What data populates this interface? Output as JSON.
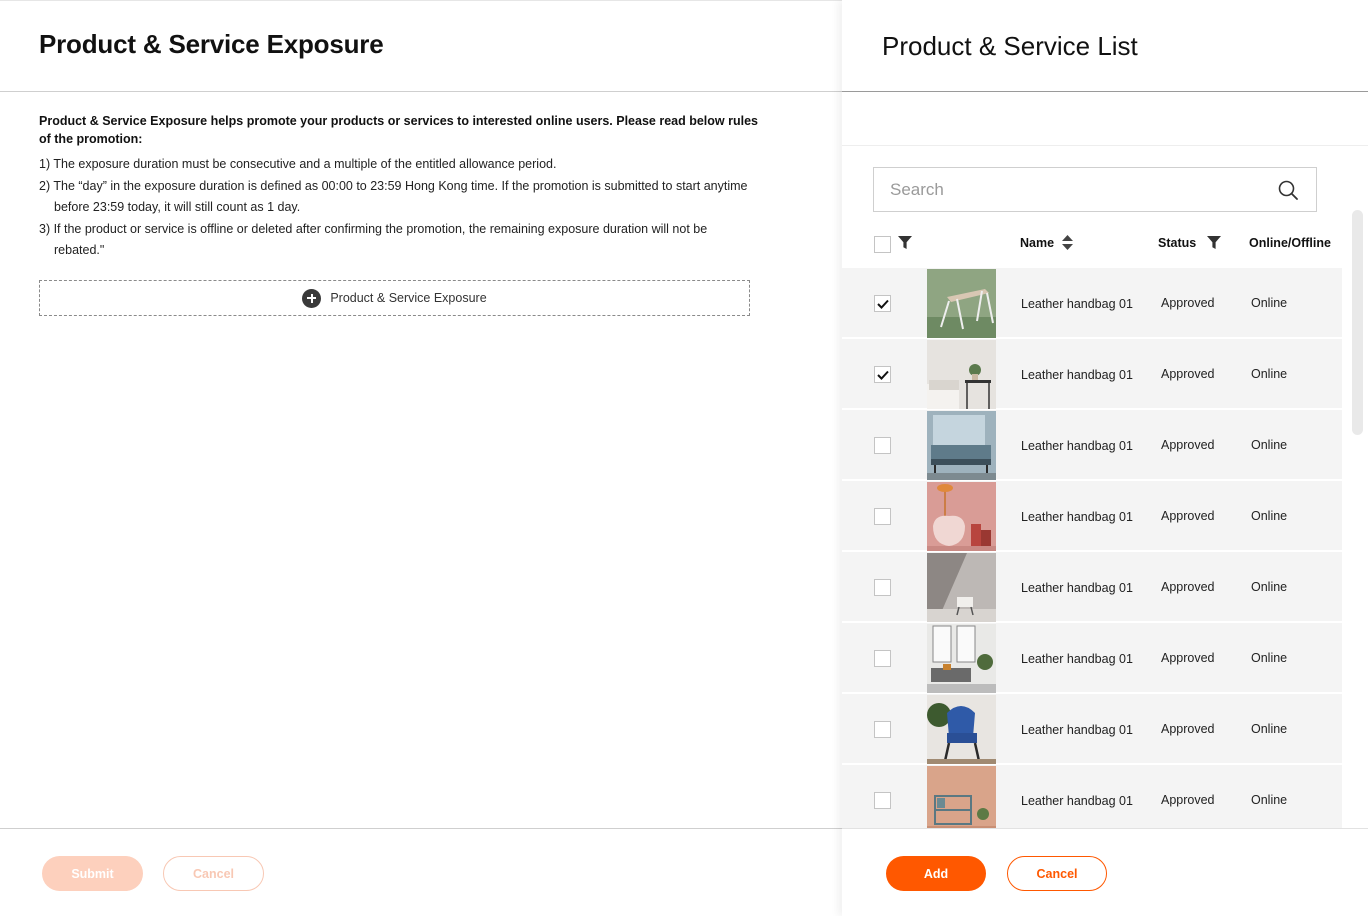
{
  "left": {
    "title": "Product & Service Exposure",
    "intro": "Product & Service Exposure helps promote your products or services to interested online users. Please read below rules of the promotion:",
    "rules": [
      "1) The exposure duration must be consecutive and a multiple of the entitled allowance period.",
      "2) The “day” in the  exposure duration is defined as 00:00 to 23:59 Hong Kong time. If the promotion is submitted to start anytime before 23:59 today, it will still count as 1 day.",
      "3) If the product or service is offline or deleted after confirming the promotion, the remaining exposure duration will not be rebated.\""
    ],
    "add_label": "Product & Service Exposure",
    "submit_label": "Submit",
    "cancel_label": "Cancel"
  },
  "right": {
    "title": "Product & Service List",
    "search": {
      "placeholder": "Search",
      "value": ""
    },
    "columns": {
      "name": "Name",
      "status": "Status",
      "online": "Online/Offline"
    },
    "rows": [
      {
        "checked": true,
        "name": "Leather handbag 01",
        "status": "Approved",
        "online": "Online",
        "image": "chair-green-wall"
      },
      {
        "checked": true,
        "name": "Leather handbag 01",
        "status": "Approved",
        "online": "Online",
        "image": "white-bed-plant"
      },
      {
        "checked": false,
        "name": "Leather handbag 01",
        "status": "Approved",
        "online": "Online",
        "image": "sofa-window"
      },
      {
        "checked": false,
        "name": "Leather handbag 01",
        "status": "Approved",
        "online": "Online",
        "image": "pink-armchair"
      },
      {
        "checked": false,
        "name": "Leather handbag 01",
        "status": "Approved",
        "online": "Online",
        "image": "gray-room-chair"
      },
      {
        "checked": false,
        "name": "Leather handbag 01",
        "status": "Approved",
        "online": "Online",
        "image": "living-room"
      },
      {
        "checked": false,
        "name": "Leather handbag 01",
        "status": "Approved",
        "online": "Online",
        "image": "blue-armchair"
      },
      {
        "checked": false,
        "name": "Leather handbag 01",
        "status": "Approved",
        "online": "Online",
        "image": "peach-shelf"
      }
    ],
    "add_label": "Add",
    "cancel_label": "Cancel"
  },
  "colors": {
    "accent": "#ff5800",
    "accent_disabled": "#fdd0bd",
    "row_bg": "#f4f4f4"
  }
}
